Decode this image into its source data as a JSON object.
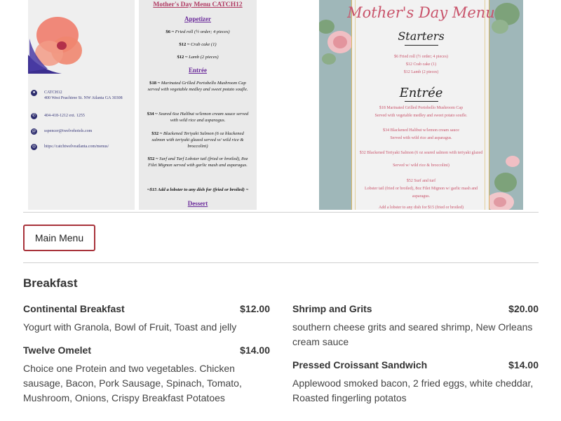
{
  "menu_image_1": {
    "contact": {
      "name": "CATCH12",
      "address": "400 West Peachtree St. NW Atlanta GA 30308",
      "phone": "404-418-1212 ext. 1255",
      "email": "sspencer@twelvehotels.com",
      "website": "https://catchtwelveatlanta.com/menus/"
    },
    "title": "Mother's Day Menu CATCH12",
    "sections": {
      "appetizer_heading": "Appetizer",
      "appetizer_items": [
        {
          "price": "$6 ~",
          "text": "Fried roll (½ order; 4 pieces)"
        },
        {
          "price": "$12 ~",
          "text": "Crab cake (1)"
        },
        {
          "price": "$12 ~",
          "text": "Lamb (2 pieces)"
        }
      ],
      "entree_heading": "Entrée",
      "entree_items": [
        {
          "price": "$18 ~",
          "text": "Marinated Grilled Portobello Mushroom Cap served with vegetable medley and sweet potato soufle."
        },
        {
          "price": "$34 ~",
          "text": "Seared 6oz Halibut w/lemon cream sauce served with wild rice and asparagus."
        },
        {
          "price": "$32 ~",
          "text": "Blackened Teriyaki Salmon (6 oz blackened salmon with teriyaki glazed served w/ wild rice & broccolini)"
        },
        {
          "price": "$52 ~",
          "text": "Surf and Turf Lobster tail (fried or broiled), 8oz Filet Mignon served with garlic mash and asparagus."
        }
      ],
      "lobster_note": "~$15 Add a lobster to any dish for (fried or broiled) ~",
      "dessert_heading": "Dessert"
    }
  },
  "menu_image_2": {
    "title": "Mother's Day Menu",
    "starters_heading": "Starters",
    "starters_items": [
      "$6 Fried roll (½ order; 4 pieces)",
      "$12 Crab cake (1)",
      "$12 Lamb (2 pieces)"
    ],
    "entree_heading": "Entrée",
    "entree_items": [
      "$18 Marinated Grilled Portobello Mushroom Cap",
      "Served with vegetable medley and sweet potato soufle.",
      "$34 Blackened Halibut w/lemon cream sauce",
      "Served with wild rice and asparagus.",
      "$32 Blackened Teriyaki Salmon (6 oz seared salmon with teriyaki glazed",
      "Served w/ wild rice & broccolini)",
      "$52 Surf and turf",
      "Lobster tail (fried or broiled), 8oz Filet Mignon w/ garlic mash and",
      "asparagus.",
      "Add a lobster to any dish for $15 (fried or broiled)"
    ]
  },
  "tabs": {
    "main_menu": "Main Menu"
  },
  "breakfast": {
    "title": "Breakfast",
    "left": [
      {
        "name": "Continental Breakfast",
        "price": "$12.00",
        "desc": "Yogurt with Granola, Bowl of Fruit, Toast and jelly"
      },
      {
        "name": "Twelve Omelet",
        "price": "$14.00",
        "desc": "Choice one Protein and two vegetables. Chicken sausage, Bacon, Pork Sausage, Spinach, Tomato, Mushroom, Onions, Crispy Breakfast Potatoes"
      }
    ],
    "right": [
      {
        "name": "Shrimp and Grits",
        "price": "$20.00",
        "desc": "southern cheese grits and seared shrimp, New Orleans cream sauce"
      },
      {
        "name": "Pressed Croissant Sandwich",
        "price": "$14.00",
        "desc": "Applewood smoked bacon, 2 fried eggs, white cheddar, Roasted fingerling potatos"
      }
    ]
  },
  "colors": {
    "accent": "#a8323a",
    "menu_pink": "#c9546b",
    "menu_purple": "#6a2a9a",
    "menu_teal": "#9fb7b9"
  }
}
